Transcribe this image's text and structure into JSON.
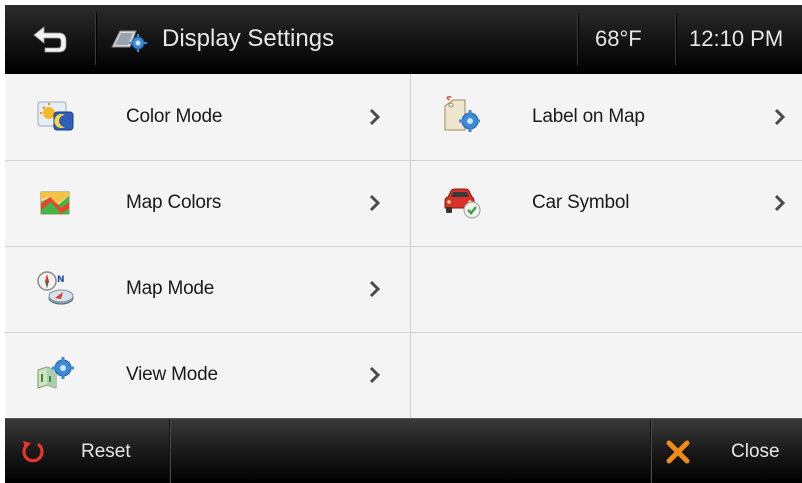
{
  "header": {
    "title": "Display Settings",
    "temperature": "68°F",
    "time": "12:10 PM"
  },
  "menu": {
    "left": [
      {
        "label": "Color Mode",
        "icon": "day-night-icon"
      },
      {
        "label": "Map Colors",
        "icon": "map-colors-icon"
      },
      {
        "label": "Map Mode",
        "icon": "compass-icon"
      },
      {
        "label": "View Mode",
        "icon": "view-mode-icon"
      }
    ],
    "right": [
      {
        "label": "Label on Map",
        "icon": "label-tag-icon"
      },
      {
        "label": "Car Symbol",
        "icon": "car-symbol-icon"
      }
    ]
  },
  "footer": {
    "reset_label": "Reset",
    "close_label": "Close"
  },
  "colors": {
    "header_bg": "#151515",
    "list_bg": "#f4f4f4",
    "reset_icon": "#e8352a",
    "close_icon": "#f08c1a"
  }
}
